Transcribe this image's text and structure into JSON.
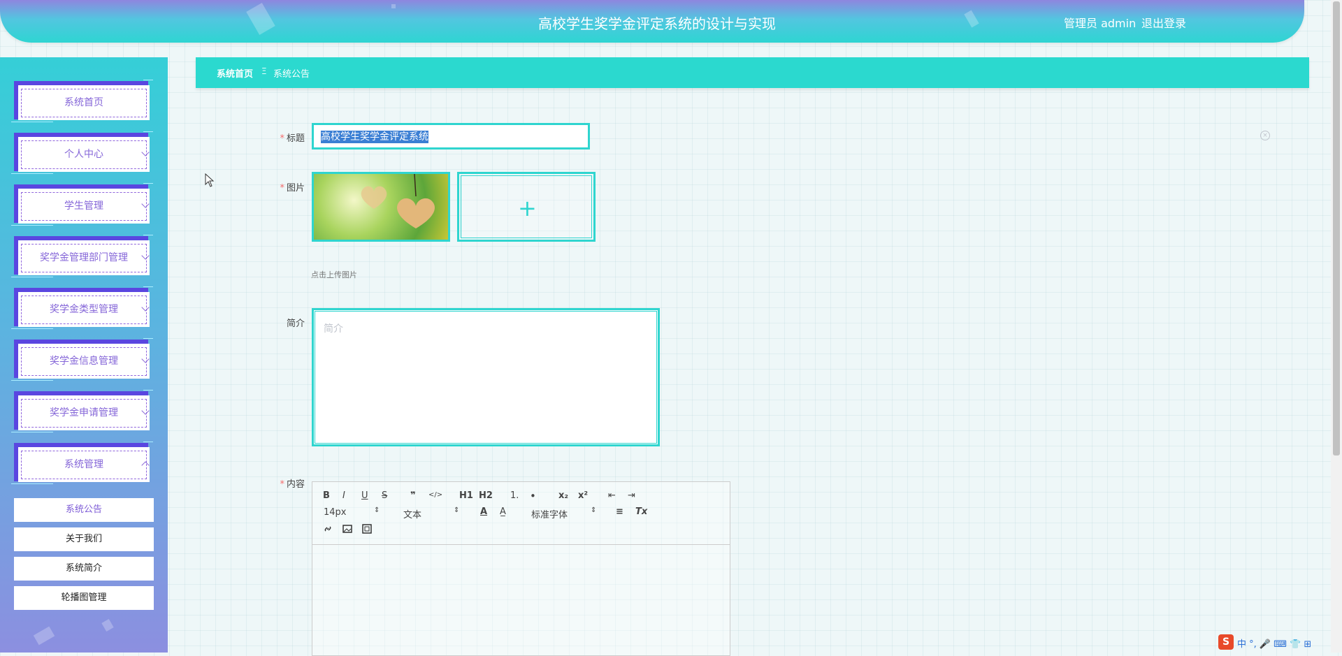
{
  "header": {
    "title": "高校学生奖学金评定系统的设计与实现",
    "user": "管理员 admin",
    "logout": "退出登录"
  },
  "sidebar": {
    "items": [
      {
        "label": "系统首页",
        "has_children": false
      },
      {
        "label": "个人中心",
        "has_children": true
      },
      {
        "label": "学生管理",
        "has_children": true
      },
      {
        "label": "奖学金管理部门管理",
        "has_children": true
      },
      {
        "label": "奖学金类型管理",
        "has_children": true
      },
      {
        "label": "奖学金信息管理",
        "has_children": true
      },
      {
        "label": "奖学金申请管理",
        "has_children": true
      },
      {
        "label": "系统管理",
        "has_children": true,
        "expanded": true
      }
    ],
    "sub_items": [
      "系统公告",
      "关于我们",
      "系统简介",
      "轮播图管理"
    ],
    "active_sub": "系统公告"
  },
  "breadcrumb": {
    "home": "系统首页",
    "separator": "Ξ",
    "current": "系统公告"
  },
  "form": {
    "title_label": "标题",
    "title_value": "高校学生奖学金评定系统",
    "image_label": "图片",
    "upload_hint": "点击上传图片",
    "desc_label": "简介",
    "desc_placeholder": "简介",
    "content_label": "内容",
    "required_mark": "*"
  },
  "editor": {
    "row1": [
      "B",
      "I",
      "U",
      "S",
      "❞",
      "</>",
      "H1",
      "H2",
      "1.",
      "•",
      "x₂",
      "x²",
      "⇤",
      "⇥"
    ],
    "font_size": "14px",
    "header_select": "文本",
    "font_family": "标准字体",
    "row2_icons": [
      "A",
      "A̲",
      "≡",
      "Tx"
    ],
    "row3": [
      "link",
      "image",
      "video"
    ]
  },
  "ime": {
    "logo": "S",
    "text": "中 °, 🎤 ⌨ 👕 ⊞"
  },
  "colors": {
    "accent": "#2fd5cf",
    "sidebar_text": "#8566d8",
    "header_gradient_top": "#8e86df"
  }
}
